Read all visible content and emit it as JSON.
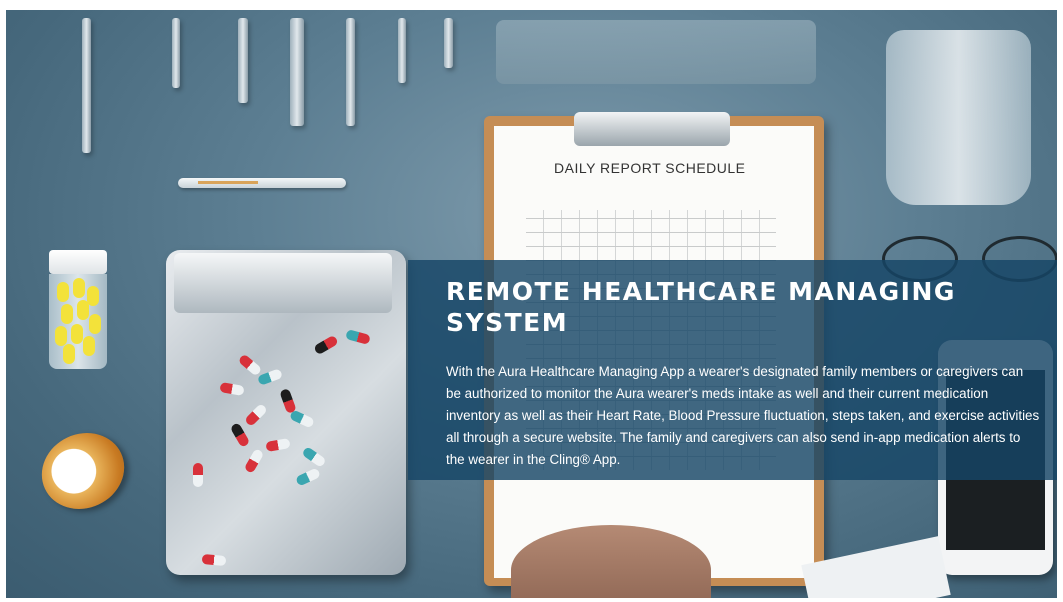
{
  "hero": {
    "image_alt": "Medical supplies flat lay with clipboard",
    "clipboard_title": "DAILY REPORT SCHEDULE"
  },
  "overlay": {
    "title": "REMOTE HEALTHCARE MANAGING SYSTEM",
    "body": "With the Aura Healthcare Managing App a wearer's designated family members or caregivers can be authorized to monitor the Aura wearer's meds intake as well and their current medication inventory as well as their Heart Rate, Blood Pressure fluctuation, steps taken, and exercise activities all through a secure website. The family and caregivers can also send in-app medication alerts to the wearer in the Cling® App."
  },
  "colors": {
    "overlay_bg": "#164666",
    "text": "#ffffff"
  }
}
